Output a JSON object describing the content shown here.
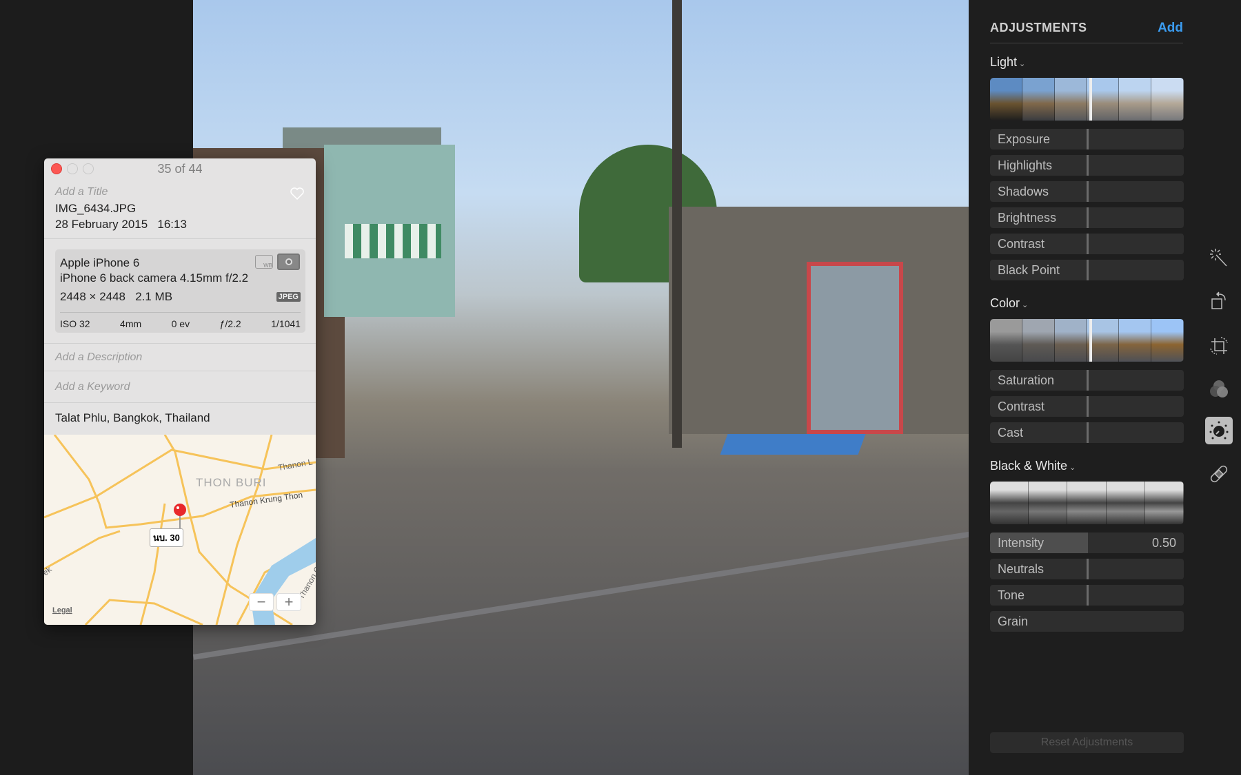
{
  "info": {
    "counter": "35 of 44",
    "title_placeholder": "Add a Title",
    "filename": "IMG_6434.JPG",
    "date": "28 February 2015",
    "time": "16:13",
    "camera": {
      "model": "Apple iPhone 6",
      "lens": "iPhone 6 back camera 4.15mm f/2.2",
      "dimensions": "2448 × 2448",
      "size": "2.1 MB",
      "format": "JPEG",
      "wb_label": "WB",
      "exif": [
        "ISO 32",
        "4mm",
        "0 ev",
        "ƒ/2.2",
        "1/1041"
      ]
    },
    "description_placeholder": "Add a Description",
    "keyword_placeholder": "Add a Keyword",
    "location": "Talat Phlu, Bangkok, Thailand",
    "map": {
      "district": "THON BURI",
      "road1": "Thanon Krung Thon",
      "road2": "Thanon L",
      "road3": "Thanon C",
      "road4": "ek",
      "pin_label": "นบ. 30",
      "legal": "Legal",
      "zoom_out": "−",
      "zoom_in": "+",
      "pin_color": "#e8282b"
    }
  },
  "adjustments": {
    "title": "ADJUSTMENTS",
    "add": "Add",
    "accent": "#3b9cf0",
    "sections": [
      {
        "label": "Light",
        "sliders": [
          {
            "label": "Exposure"
          },
          {
            "label": "Highlights"
          },
          {
            "label": "Shadows"
          },
          {
            "label": "Brightness"
          },
          {
            "label": "Contrast"
          },
          {
            "label": "Black Point"
          }
        ]
      },
      {
        "label": "Color",
        "sliders": [
          {
            "label": "Saturation"
          },
          {
            "label": "Contrast"
          },
          {
            "label": "Cast"
          }
        ]
      },
      {
        "label": "Black & White",
        "sliders": [
          {
            "label": "Intensity",
            "value": "0.50"
          },
          {
            "label": "Neutrals"
          },
          {
            "label": "Tone"
          },
          {
            "label": "Grain"
          }
        ]
      }
    ],
    "reset": "Reset Adjustments"
  },
  "tools": [
    "magic-wand",
    "rotate",
    "crop",
    "filters",
    "adjust",
    "retouch"
  ],
  "active_tool": "adjust"
}
